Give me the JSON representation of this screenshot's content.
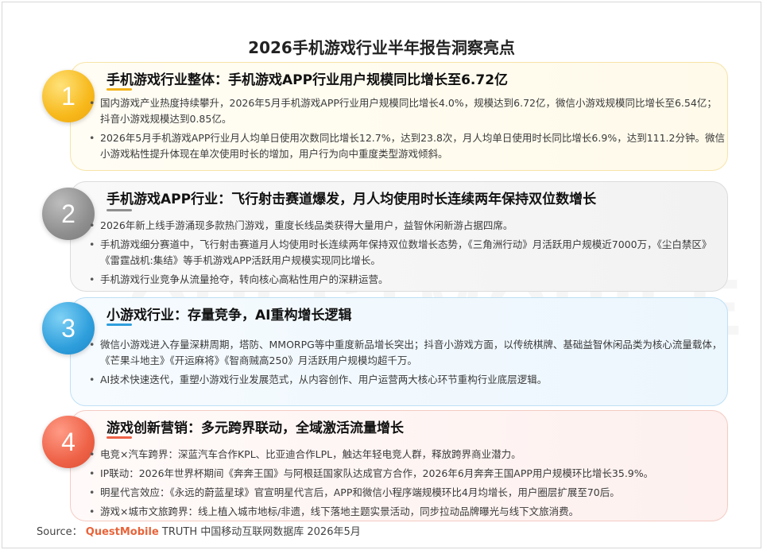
{
  "page_title": "2026手机游戏行业半年报告洞察亮点",
  "watermark": "QUESTMOBILE",
  "sections": [
    {
      "number": "1",
      "heading": "手机游戏行业整体：手机游戏APP行业用户规模同比增长至6.72亿",
      "bullets": [
        "国内游戏产业热度持续攀升，2026年5月手机游戏APP行业用户规模同比增长4.0%，规模达到6.72亿，微信小游戏规模同比增长至6.54亿；抖音小游戏规模达到0.85亿。",
        "2026年5月手机游戏APP行业月人均单日使用次数同比增长12.7%，达到23.8次，月人均单日使用时长同比增长6.9%，达到111.2分钟。微信小游戏粘性提升体现在单次使用时长的增加，用户行为向中重度类型游戏倾斜。"
      ]
    },
    {
      "number": "2",
      "heading": "手机游戏APP行业：飞行射击赛道爆发，月人均使用时长连续两年保持双位数增长",
      "bullets": [
        "2026年新上线手游涌现多款热门游戏，重度长线品类获得大量用户，益智休闲新游占据四席。",
        "手机游戏细分赛道中，飞行射击赛道月人均使用时长连续两年保持双位数增长态势，《三角洲行动》月活跃用户规模近7000万，《尘白禁区》《雷霆战机:集结》等手机游戏APP活跃用户规模实现同比增长。",
        "手机游戏行业竞争从流量抢夺，转向核心高粘性用户的深耕运营。"
      ]
    },
    {
      "number": "3",
      "heading": "小游戏行业：存量竞争，AI重构增长逻辑",
      "bullets": [
        "微信小游戏进入存量深耕周期，塔防、MMORPG等中重度新品增长突出；抖音小游戏方面，以传统棋牌、基础益智休闲品类为核心流量载体，《芒果斗地主》《开运麻将》《智商贼高250》月活跃用户规模均超千万。",
        "AI技术快速迭代，重塑小游戏行业发展范式，从内容创作、用户运营两大核心环节重构行业底层逻辑。"
      ]
    },
    {
      "number": "4",
      "heading": "游戏创新营销：多元跨界联动，全域激活流量增长",
      "bullets": [
        "电竞×汽车跨界：深蓝汽车合作KPL、比亚迪合作LPL，触达年轻电竞人群，释放跨界商业潜力。",
        "IP联动：2026年世界杯期间《奔奔王国》与阿根廷国家队达成官方合作，2026年6月奔奔王国APP用户规模环比增长35.9%。",
        "明星代言效应：《永远的蔚蓝星球》官宣明星代言后，APP和微信小程序端规模环比4月均增长，用户圈层扩展至70后。",
        "游戏×城市文旅跨界：线上植入城市地标/非遗，线下落地主题实景活动，同步拉动品牌曝光与线下文旅消费。"
      ]
    }
  ],
  "source": {
    "prefix": "Source：",
    "brand": "QuestMobile",
    "suffix": "TRUTH 中国移动互联网数据库 2026年5月"
  },
  "colors": {
    "section_1": "#f2b21a",
    "section_2": "#8f8f8f",
    "section_3": "#2f9fdc",
    "section_4": "#ee6247",
    "brand": "#e8643a"
  }
}
